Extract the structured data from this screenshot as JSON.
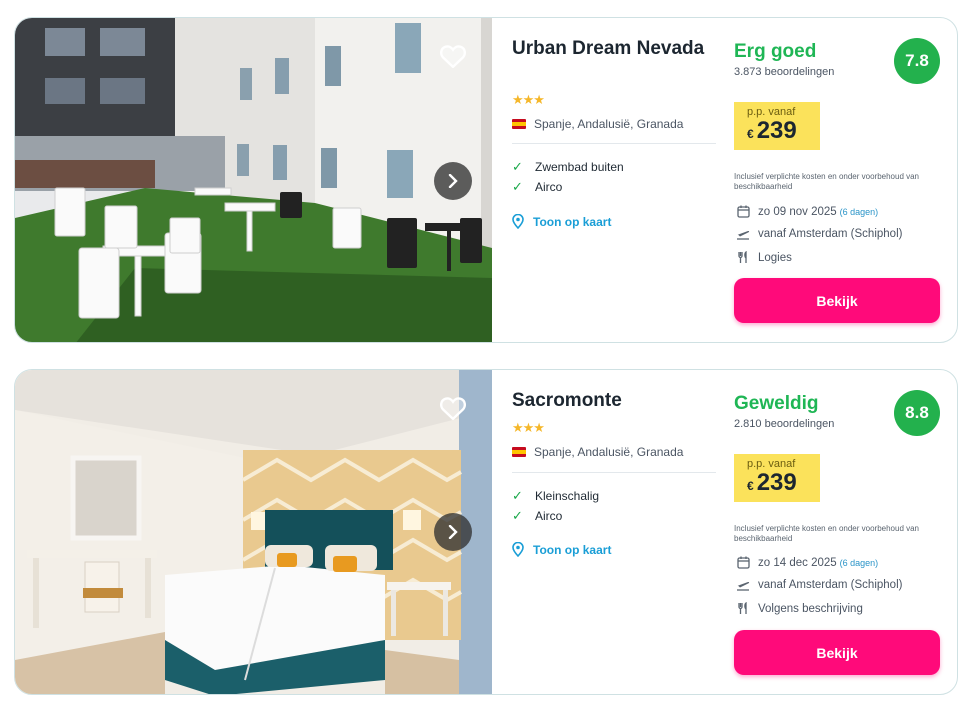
{
  "results": [
    {
      "name": "Urban Dream Nevada",
      "stars": "★★★",
      "location": "Spanje, Andalusië, Granada",
      "features": [
        "Zwembad buiten",
        "Airco"
      ],
      "map_link": "Toon op kaart",
      "rating_word": "Erg goed",
      "reviews": "3.873 beoordelingen",
      "score": "7.8",
      "price_label": "p.p. vanaf",
      "currency": "€",
      "price": "239",
      "disclaimer": "Inclusief verplichte kosten en onder voorbehoud van beschikbaarheid",
      "date": "zo 09 nov 2025",
      "days": "(6 dagen)",
      "departure": "vanaf Amsterdam (Schiphol)",
      "board": "Logies",
      "button": "Bekijk"
    },
    {
      "name": "Sacromonte",
      "stars": "★★★",
      "location": "Spanje, Andalusië, Granada",
      "features": [
        "Kleinschalig",
        "Airco"
      ],
      "map_link": "Toon op kaart",
      "rating_word": "Geweldig",
      "reviews": "2.810 beoordelingen",
      "score": "8.8",
      "price_label": "p.p. vanaf",
      "currency": "€",
      "price": "239",
      "disclaimer": "Inclusief verplichte kosten en onder voorbehoud van beschikbaarheid",
      "date": "zo 14 dec 2025",
      "days": "(6 dagen)",
      "departure": "vanaf Amsterdam (Schiphol)",
      "board": "Volgens beschrijving",
      "button": "Bekijk"
    }
  ],
  "colors": {
    "accent_button": "#ff0a7a",
    "rating_green": "#23b14d",
    "price_bg": "#fbe25b",
    "link_blue": "#1a9ed6",
    "star_gold": "#f5b72a"
  },
  "icons": [
    "heart-icon",
    "chevron-right-icon",
    "flag-spain-icon",
    "check-icon",
    "map-pin-icon",
    "calendar-icon",
    "plane-icon",
    "cutlery-icon"
  ]
}
